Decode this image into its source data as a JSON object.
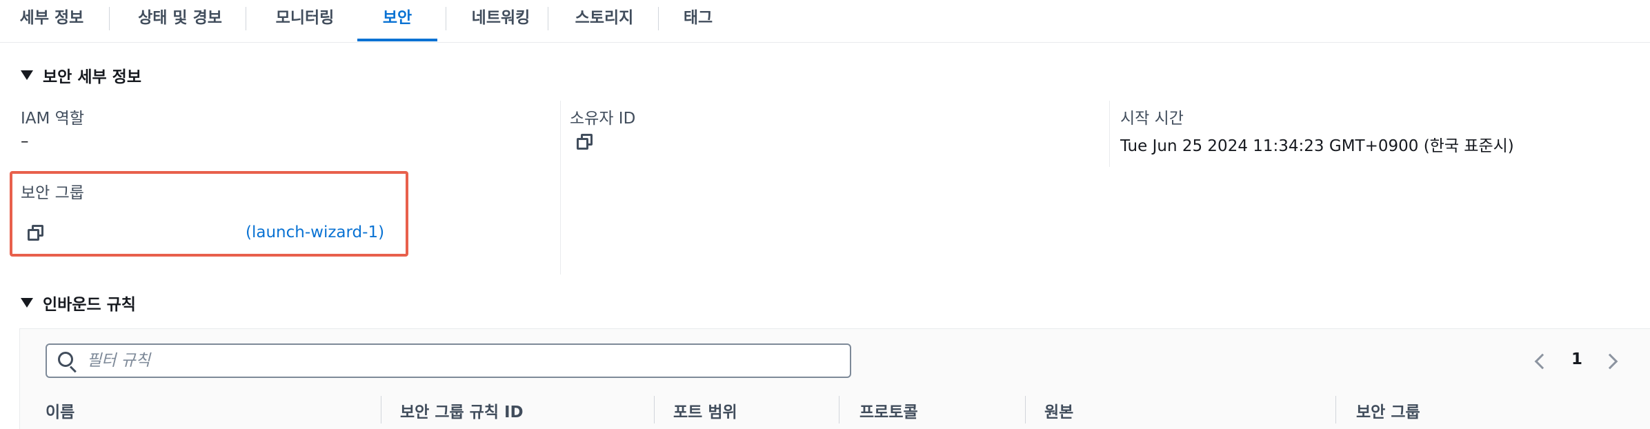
{
  "tabs": [
    {
      "label": "세부 정보",
      "active": false
    },
    {
      "label": "상태 및 경보",
      "active": false
    },
    {
      "label": "모니터링",
      "active": false
    },
    {
      "label": "보안",
      "active": true
    },
    {
      "label": "네트워킹",
      "active": false
    },
    {
      "label": "스토리지",
      "active": false
    },
    {
      "label": "태그",
      "active": false
    }
  ],
  "security_details": {
    "title": "보안 세부 정보",
    "iam_role_label": "IAM 역할",
    "iam_role_value": "–",
    "owner_id_label": "소유자 ID",
    "owner_id_value": "",
    "launch_time_label": "시작 시간",
    "launch_time_value": "Tue Jun 25 2024 11:34:23 GMT+0900 (한국 표준시)",
    "security_groups_label": "보안 그룹",
    "security_group_link": "(launch-wizard-1)"
  },
  "inbound_rules": {
    "title": "인바운드 규칙",
    "filter_placeholder": "필터 규칙",
    "page": "1",
    "columns": [
      "이름",
      "보안 그룹 규칙 ID",
      "포트 범위",
      "프로토콜",
      "원본",
      "보안 그룹"
    ]
  },
  "colors": {
    "accent": "#0972d3",
    "highlight": "#e8604c",
    "text": "#16191f",
    "muted": "#414d5c"
  },
  "icons": [
    "copy-icon",
    "search-icon",
    "chevron-left-icon",
    "chevron-right-icon",
    "caret-down-icon"
  ]
}
